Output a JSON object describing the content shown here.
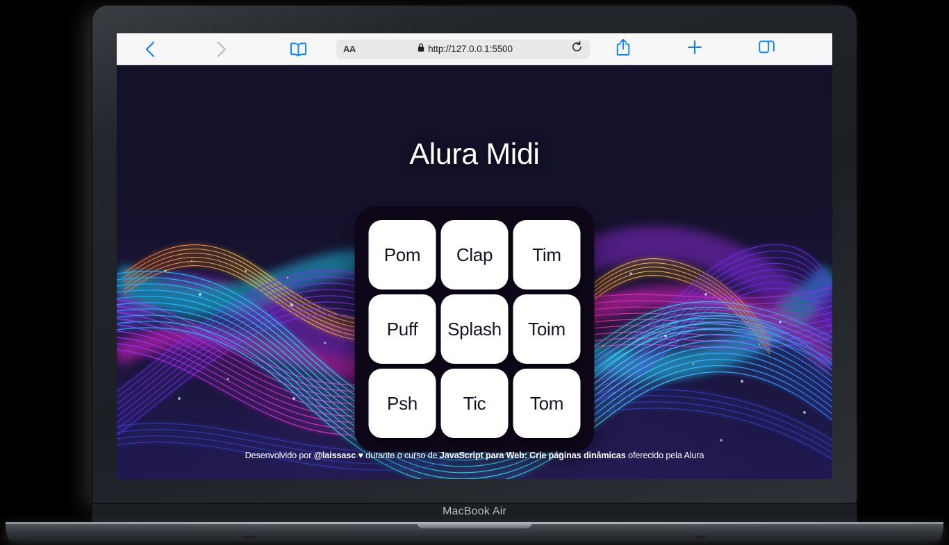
{
  "device": {
    "model_label": "MacBook Air",
    "camera_icon": "camera-dot"
  },
  "browser": {
    "back_icon": "chevron-left-icon",
    "forward_icon": "chevron-right-icon",
    "bookmarks_icon": "open-book-icon",
    "share_icon": "share-up-arrow-icon",
    "new_tab_icon": "plus-icon",
    "tabs_icon": "overlapping-squares-icon",
    "reload_icon": "reload-circular-arrow-icon",
    "lock_icon": "lock-icon",
    "text_size_label": "AA",
    "url": "http://127.0.0.1:5500",
    "colors": {
      "accent": "#0b84ff",
      "disabled": "#b9b9bc",
      "toolbar_bg": "#f7f7f7",
      "url_field_bg": "#e8e8e9"
    }
  },
  "page": {
    "title": "Alura Midi",
    "background_colors": {
      "deep_navy": "#141129",
      "indigo": "#201951",
      "panel": "#0d0718",
      "cyan": "#22e0f0",
      "magenta": "#e421c8",
      "purple": "#7b2ff7",
      "orange": "#ffa41b",
      "blue": "#2b5cf5"
    },
    "pads": [
      {
        "label": "Pom"
      },
      {
        "label": "Clap"
      },
      {
        "label": "Tim"
      },
      {
        "label": "Puff"
      },
      {
        "label": "Splash"
      },
      {
        "label": "Toim"
      },
      {
        "label": "Psh"
      },
      {
        "label": "Tic"
      },
      {
        "label": "Tom"
      }
    ],
    "footer": {
      "part1": "Desenvolvido por ",
      "part2_bold": "@laissasc ♥",
      "part3": " durante o curso de ",
      "part4_bold": "JavaScript para Web: Crie páginas dinâmicas",
      "part5": " oferecido pela Alura"
    }
  }
}
